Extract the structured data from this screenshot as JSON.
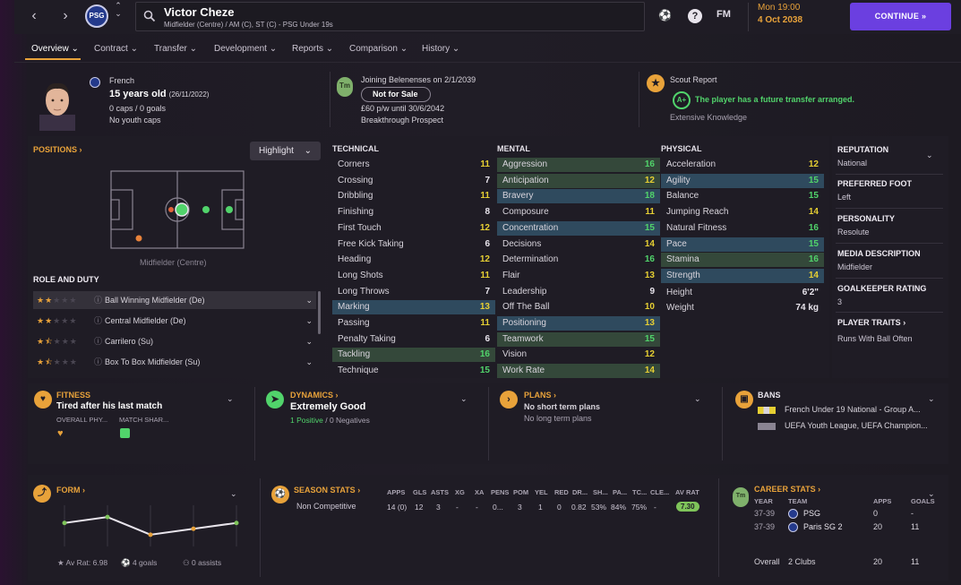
{
  "topbar": {
    "player_name": "Victor Cheze",
    "player_sub": "Midfielder (Centre) / AM (C), ST (C) - PSG Under 19s",
    "club_crest": "PSG",
    "fm_label": "FM",
    "date_time": "Mon 19:00",
    "date": "4 Oct 2038",
    "continue_label": "CONTINUE"
  },
  "subnav": [
    "Overview",
    "Contract",
    "Transfer",
    "Development",
    "Reports",
    "Comparison",
    "History"
  ],
  "profile": {
    "nationality": "French",
    "age": "15 years old",
    "dob": "(26/11/2022)",
    "caps": "0 caps / 0 goals",
    "youth_caps": "No youth caps"
  },
  "contract": {
    "joining": "Joining Belenenses on 2/1/2039",
    "status": "Not for Sale",
    "wage": "£60 p/w until 30/6/2042",
    "prospect": "Breakthrough Prospect",
    "badge": "Tm"
  },
  "scout": {
    "title": "Scout Report",
    "grade": "A+",
    "note": "The player has a future transfer arranged.",
    "knowledge": "Extensive Knowledge"
  },
  "positions": {
    "title": "POSITIONS",
    "highlight": "Highlight",
    "caption": "Midfielder (Centre)",
    "role_title": "ROLE AND DUTY",
    "roles": [
      {
        "name": "Ball Winning Midfielder (De)",
        "stars": 2
      },
      {
        "name": "Central Midfielder (De)",
        "stars": 2
      },
      {
        "name": "Carrilero (Su)",
        "stars": 1.5
      },
      {
        "name": "Box To Box Midfielder (Su)",
        "stars": 1.5
      }
    ]
  },
  "attributes": {
    "technical_title": "TECHNICAL",
    "mental_title": "MENTAL",
    "physical_title": "PHYSICAL",
    "technical": [
      {
        "n": "Corners",
        "v": "11",
        "c": "y",
        "h": ""
      },
      {
        "n": "Crossing",
        "v": "7",
        "c": "w",
        "h": ""
      },
      {
        "n": "Dribbling",
        "v": "11",
        "c": "y",
        "h": ""
      },
      {
        "n": "Finishing",
        "v": "8",
        "c": "w",
        "h": ""
      },
      {
        "n": "First Touch",
        "v": "12",
        "c": "y",
        "h": ""
      },
      {
        "n": "Free Kick Taking",
        "v": "6",
        "c": "w",
        "h": ""
      },
      {
        "n": "Heading",
        "v": "12",
        "c": "y",
        "h": ""
      },
      {
        "n": "Long Shots",
        "v": "11",
        "c": "y",
        "h": ""
      },
      {
        "n": "Long Throws",
        "v": "7",
        "c": "w",
        "h": ""
      },
      {
        "n": "Marking",
        "v": "13",
        "c": "y",
        "h": "hl"
      },
      {
        "n": "Passing",
        "v": "11",
        "c": "y",
        "h": ""
      },
      {
        "n": "Penalty Taking",
        "v": "6",
        "c": "w",
        "h": ""
      },
      {
        "n": "Tackling",
        "v": "16",
        "c": "g",
        "h": "gr"
      },
      {
        "n": "Technique",
        "v": "15",
        "c": "g",
        "h": ""
      }
    ],
    "mental": [
      {
        "n": "Aggression",
        "v": "16",
        "c": "g",
        "h": "gr"
      },
      {
        "n": "Anticipation",
        "v": "12",
        "c": "y",
        "h": "gr"
      },
      {
        "n": "Bravery",
        "v": "18",
        "c": "g",
        "h": "hl"
      },
      {
        "n": "Composure",
        "v": "11",
        "c": "y",
        "h": ""
      },
      {
        "n": "Concentration",
        "v": "15",
        "c": "g",
        "h": "hl"
      },
      {
        "n": "Decisions",
        "v": "14",
        "c": "y",
        "h": ""
      },
      {
        "n": "Determination",
        "v": "16",
        "c": "g",
        "h": ""
      },
      {
        "n": "Flair",
        "v": "13",
        "c": "y",
        "h": ""
      },
      {
        "n": "Leadership",
        "v": "9",
        "c": "w",
        "h": ""
      },
      {
        "n": "Off The Ball",
        "v": "10",
        "c": "y",
        "h": ""
      },
      {
        "n": "Positioning",
        "v": "13",
        "c": "y",
        "h": "hl"
      },
      {
        "n": "Teamwork",
        "v": "15",
        "c": "g",
        "h": "gr"
      },
      {
        "n": "Vision",
        "v": "12",
        "c": "y",
        "h": ""
      },
      {
        "n": "Work Rate",
        "v": "14",
        "c": "y",
        "h": "gr"
      }
    ],
    "physical": [
      {
        "n": "Acceleration",
        "v": "12",
        "c": "y",
        "h": ""
      },
      {
        "n": "Agility",
        "v": "15",
        "c": "g",
        "h": "hl"
      },
      {
        "n": "Balance",
        "v": "15",
        "c": "g",
        "h": ""
      },
      {
        "n": "Jumping Reach",
        "v": "14",
        "c": "y",
        "h": ""
      },
      {
        "n": "Natural Fitness",
        "v": "16",
        "c": "g",
        "h": ""
      },
      {
        "n": "Pace",
        "v": "15",
        "c": "g",
        "h": "hl"
      },
      {
        "n": "Stamina",
        "v": "16",
        "c": "g",
        "h": "gr"
      },
      {
        "n": "Strength",
        "v": "14",
        "c": "y",
        "h": "hl"
      }
    ],
    "height_label": "Height",
    "height": "6'2\"",
    "weight_label": "Weight",
    "weight": "74 kg"
  },
  "info": {
    "reputation_label": "REPUTATION",
    "reputation": "National",
    "foot_label": "PREFERRED FOOT",
    "foot": "Left",
    "personality_label": "PERSONALITY",
    "personality": "Resolute",
    "media_label": "MEDIA DESCRIPTION",
    "media": "Midfielder",
    "gk_label": "GOALKEEPER RATING",
    "gk": "3",
    "traits_label": "PLAYER TRAITS",
    "traits": "Runs With Ball Often"
  },
  "fitness": {
    "title": "FITNESS",
    "status": "Tired after his last match",
    "col1": "OVERALL PHY...",
    "col2": "MATCH SHAR..."
  },
  "dynamics": {
    "title": "DYNAMICS",
    "status": "Extremely Good",
    "positive": "1 Positive",
    "sep": " / ",
    "negative": "0 Negatives"
  },
  "plans": {
    "title": "PLANS",
    "short": "No short term plans",
    "long": "No long term plans"
  },
  "bans": {
    "title": "BANS",
    "b1": "French Under 19 National - Group A...",
    "b2": "UEFA Youth League, UEFA Champion..."
  },
  "form": {
    "title": "FORM",
    "ratings": [
      6.6,
      6.7,
      6.4,
      6.5,
      6.6
    ],
    "av_rat": "Av Rat: 6.98",
    "goals": "4 goals",
    "assists": "0 assists"
  },
  "season": {
    "title": "SEASON STATS",
    "headers": [
      "APPS",
      "GLS",
      "ASTS",
      "XG",
      "XA",
      "PENS",
      "POM",
      "YEL",
      "RED",
      "DR...",
      "SH...",
      "PA...",
      "TC...",
      "CLE...",
      "AV RAT"
    ],
    "row_label": "Non Competitive",
    "values": [
      "14 (0)",
      "12",
      "3",
      "-",
      "-",
      "0...",
      "3",
      "1",
      "0",
      "0.82",
      "53%",
      "84%",
      "75%",
      "-",
      "7.30"
    ]
  },
  "career": {
    "title": "CAREER STATS",
    "h_year": "YEAR",
    "h_team": "TEAM",
    "h_apps": "APPS",
    "h_goals": "GOALS",
    "rows": [
      {
        "year": "37-39",
        "team": "PSG",
        "apps": "0",
        "goals": "-"
      },
      {
        "year": "37-39",
        "team": "Paris SG 2",
        "apps": "20",
        "goals": "11"
      }
    ],
    "overall_label": "Overall",
    "overall_clubs": "2 Clubs",
    "overall_apps": "20",
    "overall_goals": "11"
  },
  "colors": {
    "accent": "#e8a23a",
    "continue": "#6b3fe0",
    "green": "#51d36b",
    "yellow": "#e6cf33"
  }
}
